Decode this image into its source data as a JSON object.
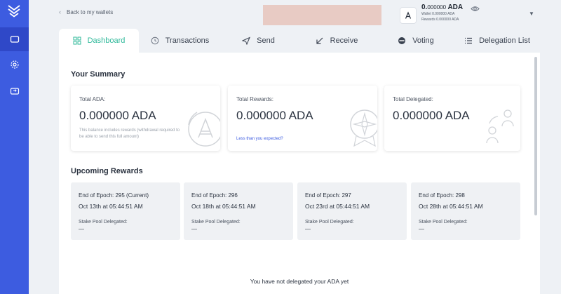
{
  "topbar": {
    "back_label": "Back to my wallets",
    "wallet": {
      "balance_int": "0.",
      "balance_frac": "000000",
      "balance_unit": " ADA",
      "wallet_line": "Wallet 0.000000 ADA",
      "rewards_line": "Rewards 0.000000 ADA"
    }
  },
  "tabs": [
    {
      "label": "Dashboard",
      "icon": "grid-icon",
      "active": true
    },
    {
      "label": "Transactions",
      "icon": "history-icon",
      "active": false
    },
    {
      "label": "Send",
      "icon": "send-icon",
      "active": false
    },
    {
      "label": "Receive",
      "icon": "receive-arrow-icon",
      "active": false
    },
    {
      "label": "Voting",
      "icon": "voting-icon",
      "active": false
    },
    {
      "label": "Delegation List",
      "icon": "list-icon",
      "active": false
    }
  ],
  "summary": {
    "title": "Your Summary",
    "cards": [
      {
        "label": "Total ADA:",
        "value": "0.000000 ADA",
        "note": "This balance includes rewards (withdrawal required to be able to send this full amount)"
      },
      {
        "label": "Total Rewards:",
        "value": "0.000000 ADA",
        "link": "Less than you expected?"
      },
      {
        "label": "Total Delegated:",
        "value": "0.000000 ADA"
      }
    ]
  },
  "upcoming": {
    "title": "Upcoming Rewards",
    "cards": [
      {
        "epoch": "End of Epoch:  295 (Current)",
        "date": "Oct 13th at 05:44:51 AM",
        "pool_label": "Stake Pool Delegated:",
        "pool_value": "—"
      },
      {
        "epoch": "End of Epoch:  296",
        "date": "Oct 18th at 05:44:51 AM",
        "pool_label": "Stake Pool Delegated:",
        "pool_value": "—"
      },
      {
        "epoch": "End of Epoch:  297",
        "date": "Oct 23rd at 05:44:51 AM",
        "pool_label": "Stake Pool Delegated:",
        "pool_value": "—"
      },
      {
        "epoch": "End of Epoch:  298",
        "date": "Oct 28th at 05:44:51 AM",
        "pool_label": "Stake Pool Delegated:",
        "pool_value": "—"
      }
    ]
  },
  "not_delegated": "You have not delegated your ADA yet",
  "colors": {
    "sidebar": "#3d5ce0",
    "accent": "#2fb99a",
    "link": "#3d5ce0"
  }
}
